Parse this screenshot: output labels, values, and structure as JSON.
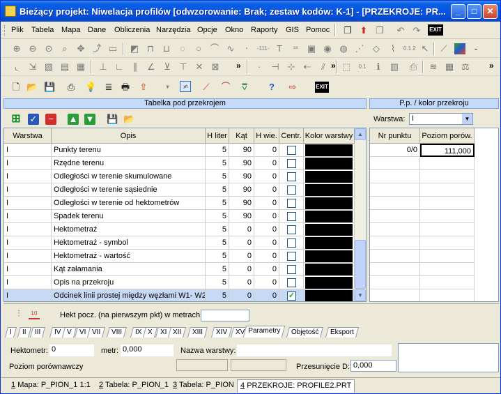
{
  "window": {
    "title": "Bieżący projekt: Niwelacja profilów [odwzorowanie: Brak; zestaw kodów: K-1] - [PRZEKROJE: PR...",
    "minimize": "_",
    "maximize": "□",
    "close": "✕"
  },
  "menu": [
    "Plik",
    "Tabela",
    "Mapa",
    "Dane",
    "Obliczenia",
    "Narzędzia",
    "Opcje",
    "Okno",
    "Raporty",
    "GIS",
    "Pomoc"
  ],
  "toolbar": {
    "exit_label": "EXIT",
    "icons": [
      "new-icon",
      "open-icon",
      "save-icon",
      "print-icon",
      "bulb-icon",
      "list-icon",
      "printer-icon",
      "export-icon",
      "xy-icon",
      "yh-icon",
      "line-icon",
      "curve-icon",
      "triangle-icon",
      "help-icon",
      "export-red-icon",
      "exit-icon"
    ]
  },
  "left_panel": {
    "header": "Tabelka pod przekrojem",
    "columns": [
      "Warstwa",
      "Opis",
      "H liter",
      "Kąt",
      "H wie.",
      "Centr.",
      "Kolor warstwy"
    ],
    "rows": [
      {
        "warstwa": "I",
        "opis": "Punkty terenu",
        "hliter": "5",
        "kat": "90",
        "hwie": "0",
        "centr": false
      },
      {
        "warstwa": "I",
        "opis": "Rzędne terenu",
        "hliter": "5",
        "kat": "90",
        "hwie": "0",
        "centr": false
      },
      {
        "warstwa": "I",
        "opis": "Odległości w terenie skumulowane",
        "hliter": "5",
        "kat": "90",
        "hwie": "0",
        "centr": false
      },
      {
        "warstwa": "I",
        "opis": "Odległości w terenie sąsiednie",
        "hliter": "5",
        "kat": "90",
        "hwie": "0",
        "centr": false
      },
      {
        "warstwa": "I",
        "opis": "Odległości w terenie od hektometrów",
        "hliter": "5",
        "kat": "90",
        "hwie": "0",
        "centr": false
      },
      {
        "warstwa": "I",
        "opis": "Spadek terenu",
        "hliter": "5",
        "kat": "90",
        "hwie": "0",
        "centr": false
      },
      {
        "warstwa": "I",
        "opis": "Hektometraż",
        "hliter": "5",
        "kat": "0",
        "hwie": "0",
        "centr": false
      },
      {
        "warstwa": "I",
        "opis": "Hektometraż - symbol",
        "hliter": "5",
        "kat": "0",
        "hwie": "0",
        "centr": false
      },
      {
        "warstwa": "I",
        "opis": "Hektometraż - wartość",
        "hliter": "5",
        "kat": "0",
        "hwie": "0",
        "centr": false
      },
      {
        "warstwa": "I",
        "opis": "Kąt załamania",
        "hliter": "5",
        "kat": "0",
        "hwie": "0",
        "centr": false
      },
      {
        "warstwa": "I",
        "opis": "Opis na przekroju",
        "hliter": "5",
        "kat": "0",
        "hwie": "0",
        "centr": false
      },
      {
        "warstwa": "I",
        "opis": "Odcinek linii prostej między węzłami W1- W2",
        "hliter": "5",
        "kat": "0",
        "hwie": "0",
        "centr": true
      }
    ],
    "hekt_label": "Hekt pocz. (na pierwszym pkt) w metrach:",
    "hekt_value": "",
    "icon_10": "10"
  },
  "right_panel": {
    "header": "P.p. / kolor przekroju",
    "warstwa_label": "Warstwa:",
    "warstwa_value": "I",
    "columns": [
      "Nr punktu",
      "Poziom porów."
    ],
    "rows": [
      {
        "nr": "0/0",
        "poziom": "111,000"
      }
    ]
  },
  "tabs": [
    "I",
    "II",
    "III",
    "IV",
    "V",
    "VI",
    "VII",
    "VIII",
    "IX",
    "X",
    "XI",
    "XII",
    "XIII",
    "XIV",
    "XV",
    "Parametry",
    "Objętość",
    "Eksport"
  ],
  "bottom": {
    "hektometr_label": "Hektometr:",
    "hektometr_value": "0",
    "metr_label": "metr:",
    "metr_value": "0,000",
    "nazwa_label": "Nazwa warstwy:",
    "nazwa_value": "",
    "poziom_label": "Poziom porównawczy",
    "przes_label": "Przesunięcie D:",
    "przes_value": "0,000"
  },
  "statusbar": [
    {
      "num": "1",
      "label": "Mapa: P_PION_1  1:1"
    },
    {
      "num": "2",
      "label": "Tabela: P_PION_1"
    },
    {
      "num": "3",
      "label": "Tabela: P_PION"
    },
    {
      "num": "4",
      "label": "PRZEKROJE: PROFILE2.PRT"
    }
  ]
}
